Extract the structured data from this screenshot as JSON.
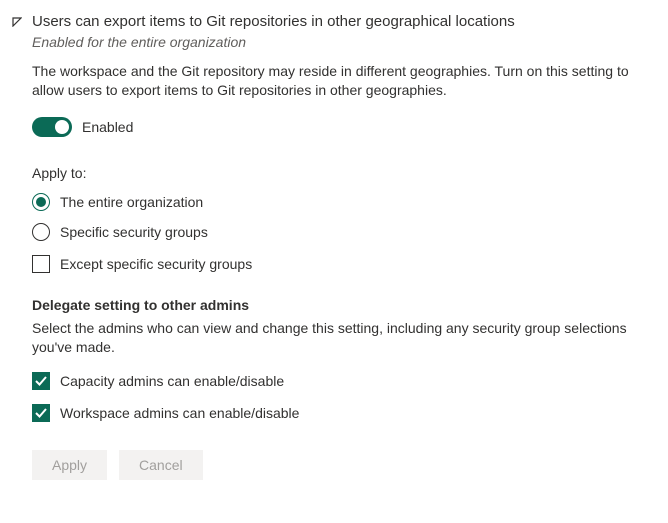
{
  "header": {
    "title": "Users can export items to Git repositories in other geographical locations",
    "subtitle": "Enabled for the entire organization"
  },
  "description": "The workspace and the Git repository may reside in different geographies. Turn on this setting to allow users to export items to Git repositories in other geographies.",
  "toggle": {
    "enabled": true,
    "label": "Enabled"
  },
  "applyTo": {
    "label": "Apply to:",
    "options": [
      {
        "label": "The entire organization",
        "selected": true
      },
      {
        "label": "Specific security groups",
        "selected": false
      }
    ],
    "except": {
      "label": "Except specific security groups",
      "checked": false
    }
  },
  "delegate": {
    "title": "Delegate setting to other admins",
    "description": "Select the admins who can view and change this setting, including any security group selections you've made.",
    "options": [
      {
        "label": "Capacity admins can enable/disable",
        "checked": true
      },
      {
        "label": "Workspace admins can enable/disable",
        "checked": true
      }
    ]
  },
  "buttons": {
    "apply": "Apply",
    "cancel": "Cancel"
  }
}
